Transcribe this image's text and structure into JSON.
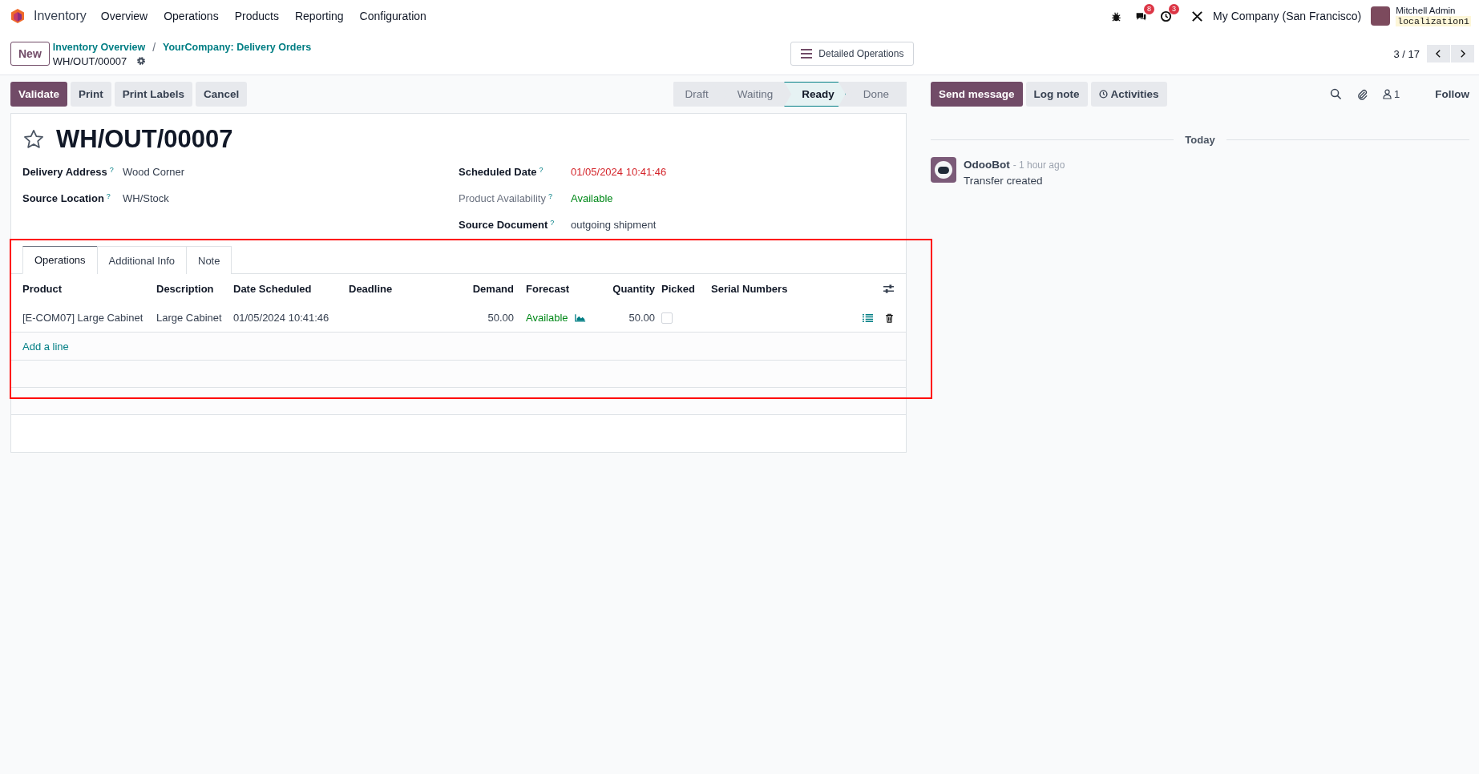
{
  "navbar": {
    "app_name": "Inventory",
    "menu": [
      "Overview",
      "Operations",
      "Products",
      "Reporting",
      "Configuration"
    ],
    "messages_count": "8",
    "activities_count": "3",
    "company": "My Company (San Francisco)",
    "user_name": "Mitchell Admin",
    "database": "localization1"
  },
  "control_panel": {
    "new_button": "New",
    "breadcrumbs": [
      "Inventory Overview",
      "YourCompany: Delivery Orders"
    ],
    "breadcrumb_separator": "/",
    "record_name": "WH/OUT/00007",
    "view_button": "Detailed Operations",
    "pager": "3 / 17"
  },
  "actions": [
    "Validate",
    "Print",
    "Print Labels",
    "Cancel"
  ],
  "status_steps": [
    {
      "label": "Draft",
      "selected": false
    },
    {
      "label": "Waiting",
      "selected": false
    },
    {
      "label": "Ready",
      "selected": true
    },
    {
      "label": "Done",
      "selected": false
    }
  ],
  "chatter_buttons": [
    "Send message",
    "Log note",
    "Activities"
  ],
  "followers_count": "1",
  "follow": "Follow",
  "record": {
    "title": "WH/OUT/00007",
    "starred": false,
    "left_fields": [
      {
        "label": "Delivery Address",
        "help": "?",
        "value": "Wood Corner",
        "readonly": false
      },
      {
        "label": "Source Location",
        "help": "?",
        "value": "WH/Stock",
        "readonly": false
      }
    ],
    "right_fields": [
      {
        "label": "Scheduled Date",
        "help": "?",
        "value": "01/05/2024 10:41:46",
        "kind": "danger",
        "readonly": false
      },
      {
        "label": "Product Availability",
        "help": "?",
        "value": "Available",
        "kind": "success",
        "readonly": true
      },
      {
        "label": "Source Document",
        "help": "?",
        "value": "outgoing shipment",
        "kind": "text",
        "readonly": false
      }
    ]
  },
  "tabs": [
    {
      "label": "Operations",
      "selected": true
    },
    {
      "label": "Additional Info",
      "selected": false
    },
    {
      "label": "Note",
      "selected": false
    }
  ],
  "table": {
    "columns": [
      "Product",
      "Description",
      "Date Scheduled",
      "Deadline",
      "Demand",
      "Forecast",
      "Quantity",
      "Picked",
      "Serial Numbers"
    ],
    "rows": [
      {
        "product": "[E-COM07] Large Cabinet",
        "description": "Large Cabinet",
        "date_scheduled": "01/05/2024 10:41:46",
        "demand": "50.00",
        "forecast": "Available",
        "quantity": "50.00",
        "picked": false
      }
    ],
    "add_line": "Add a line"
  },
  "chatter": {
    "date_separator": "Today",
    "messages": [
      {
        "author": "OdooBot",
        "time": "- 1 hour ago",
        "body": "Transfer created"
      }
    ]
  }
}
